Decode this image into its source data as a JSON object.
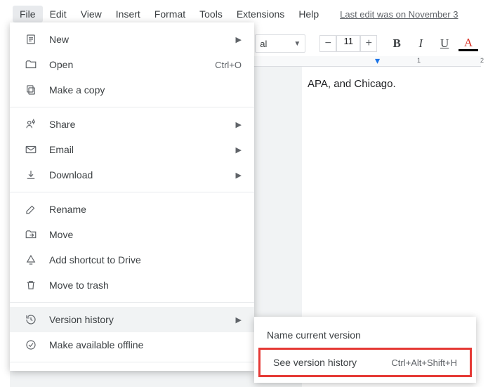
{
  "menubar": {
    "items": [
      "File",
      "Edit",
      "View",
      "Insert",
      "Format",
      "Tools",
      "Extensions",
      "Help"
    ],
    "last_edit": "Last edit was on November 3"
  },
  "toolbar": {
    "font_name_tail": "al",
    "font_size": "11",
    "minus": "−",
    "plus": "+",
    "bold": "B",
    "italic": "I",
    "underline": "U",
    "textcolor": "A"
  },
  "ruler": {
    "mark1": "1",
    "mark2": "2"
  },
  "document": {
    "visible_text": "APA, and Chicago."
  },
  "file_menu": {
    "new": "New",
    "open": "Open",
    "open_shortcut": "Ctrl+O",
    "make_copy": "Make a copy",
    "share": "Share",
    "email": "Email",
    "download": "Download",
    "rename": "Rename",
    "move": "Move",
    "add_shortcut": "Add shortcut to Drive",
    "trash": "Move to trash",
    "version_history": "Version history",
    "offline": "Make available offline"
  },
  "version_submenu": {
    "name_current": "Name current version",
    "see_history": "See version history",
    "see_history_shortcut": "Ctrl+Alt+Shift+H"
  }
}
